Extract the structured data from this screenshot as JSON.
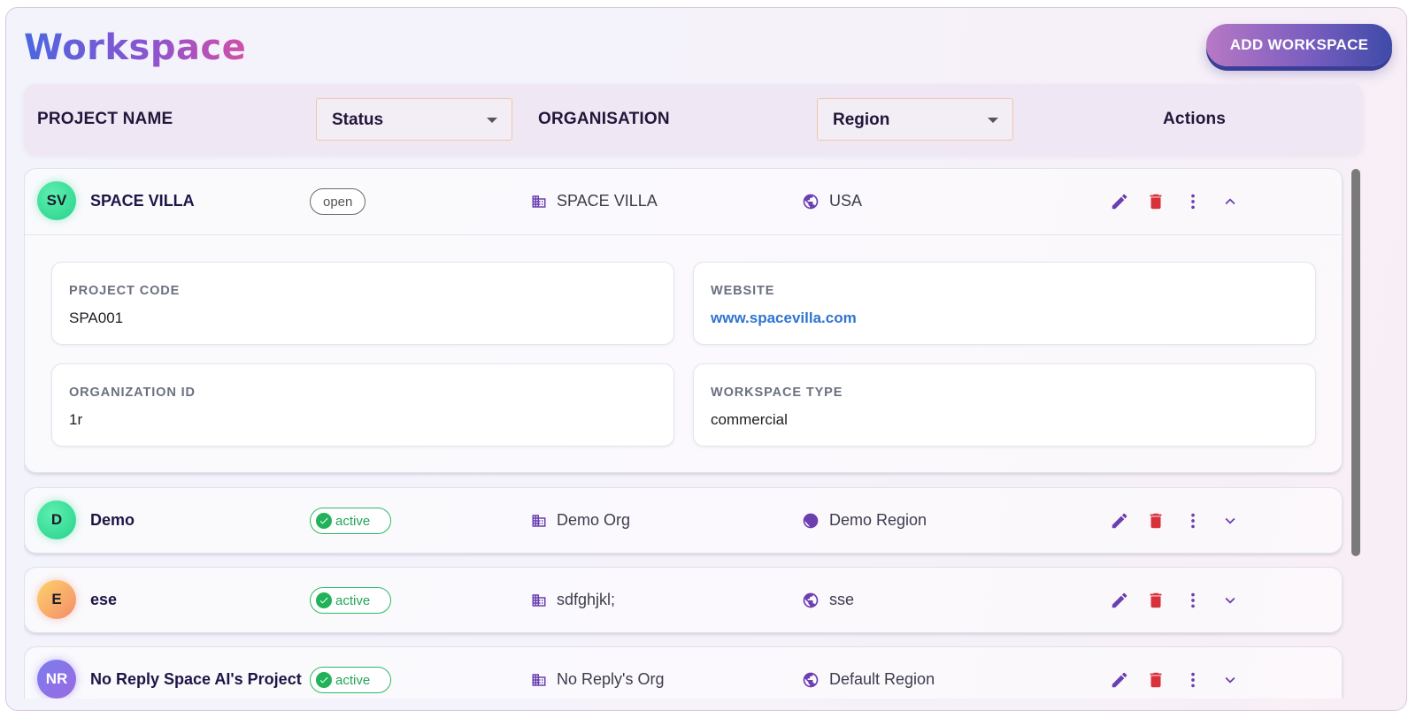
{
  "page": {
    "title": "Workspace",
    "add_button_label": "ADD WORKSPACE"
  },
  "header": {
    "project_name": "PROJECT NAME",
    "status_filter": "Status",
    "organisation": "ORGANISATION",
    "region_filter": "Region",
    "actions": "Actions"
  },
  "rows": [
    {
      "initials": "SV",
      "name": "SPACE VILLA",
      "status": "open",
      "organisation": "SPACE VILLA",
      "region": "USA",
      "expanded": true,
      "details": {
        "project_code_label": "PROJECT CODE",
        "project_code": "SPA001",
        "website_label": "WEBSITE",
        "website": "www.spacevilla.com",
        "organization_id_label": "ORGANIZATION ID",
        "organization_id": "1r",
        "workspace_type_label": "WORKSPACE TYPE",
        "workspace_type": "commercial"
      }
    },
    {
      "initials": "D",
      "name": "Demo",
      "status": "active",
      "organisation": "Demo Org",
      "region": "Demo Region",
      "expanded": false
    },
    {
      "initials": "E",
      "name": "ese",
      "status": "active",
      "organisation": "sdfghjkl;",
      "region": "sse",
      "expanded": false
    },
    {
      "initials": "NR",
      "name": "No Reply Space AI's Project",
      "status": "active",
      "organisation": "No Reply's Org",
      "region": "Default Region",
      "expanded": false
    }
  ],
  "icons": {
    "organisation": "building-icon",
    "region": "globe-icon",
    "edit": "pencil-icon",
    "delete": "trash-icon",
    "more": "more-vertical-icon",
    "collapse": "chevron-up-icon",
    "expand": "chevron-down-icon",
    "status_active": "check-circle-icon"
  },
  "colors": {
    "accent_purple": "#6b3fb0",
    "delete_red": "#d8313a",
    "active_green": "#22a55a",
    "link_blue": "#2f74d0"
  }
}
